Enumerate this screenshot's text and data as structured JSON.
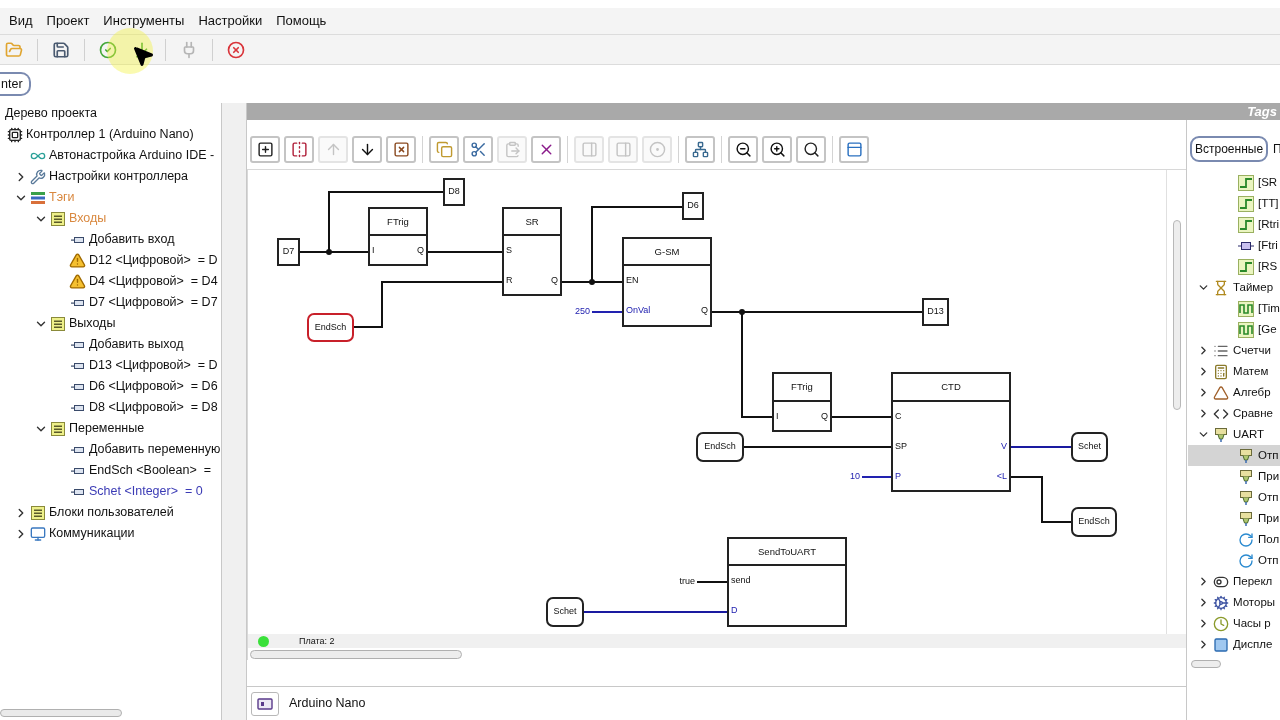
{
  "menu": [
    "Вид",
    "Проект",
    "Инструменты",
    "Настройки",
    "Помощь"
  ],
  "toolbar": [
    [
      {
        "kind": "open",
        "disabled": false
      }
    ],
    [
      {
        "kind": "save",
        "disabled": false
      }
    ],
    [
      {
        "kind": "check",
        "disabled": false
      },
      {
        "kind": "upload",
        "disabled": false
      }
    ],
    [
      {
        "kind": "plug",
        "disabled": true
      }
    ],
    [
      {
        "kind": "stop",
        "disabled": false
      }
    ]
  ],
  "side_button": {
    "label": "nter"
  },
  "project_tree": {
    "title": "Дерево проекта",
    "items": [
      {
        "label": "Контроллер 1 (Arduino Nano)",
        "kind": "controller",
        "children": [
          {
            "label": "Автонастройка Arduino IDE -",
            "kind": "link"
          },
          {
            "label": "Настройки контроллера",
            "kind": "settings",
            "expanded": false
          },
          {
            "label": "Тэги",
            "kind": "tags",
            "expanded": true,
            "color": "#d9883f",
            "children": [
              {
                "label": "Входы",
                "kind": "group",
                "expanded": true,
                "color": "#d9883f",
                "children": [
                  {
                    "label": "Добавить вход",
                    "kind": "input"
                  },
                  {
                    "label": "D12 <Цифровой>  = D",
                    "kind": "warning"
                  },
                  {
                    "label": "D4 <Цифровой>  = D4",
                    "kind": "warning"
                  },
                  {
                    "label": "D7 <Цифровой>  = D7",
                    "kind": "input"
                  }
                ]
              },
              {
                "label": "Выходы",
                "kind": "group",
                "expanded": true,
                "children": [
                  {
                    "label": "Добавить выход",
                    "kind": "output"
                  },
                  {
                    "label": "D13 <Цифровой>  = D",
                    "kind": "output"
                  },
                  {
                    "label": "D6 <Цифровой>  = D6",
                    "kind": "output"
                  },
                  {
                    "label": "D8 <Цифровой>  = D8",
                    "kind": "output"
                  }
                ]
              },
              {
                "label": "Переменные",
                "kind": "group",
                "expanded": true,
                "children": [
                  {
                    "label": "Добавить переменную",
                    "kind": "input"
                  },
                  {
                    "label": "EndSch <Boolean>  =",
                    "kind": "input"
                  },
                  {
                    "label": "Schet <Integer>  = 0",
                    "kind": "input",
                    "color": "#3b3bb5"
                  }
                ]
              }
            ]
          },
          {
            "label": "Блоки пользователей",
            "kind": "group",
            "expanded": false
          },
          {
            "label": "Коммуникации",
            "kind": "comm",
            "expanded": false
          }
        ]
      }
    ]
  },
  "panel_header": {
    "title": "Tags"
  },
  "diagram_toolbar": [
    [
      {
        "kind": "insert",
        "disabled": false
      },
      {
        "kind": "mirror",
        "disabled": false
      },
      {
        "kind": "up",
        "disabled": true
      },
      {
        "kind": "down",
        "disabled": false
      },
      {
        "kind": "delete-block",
        "disabled": false
      }
    ],
    [
      {
        "kind": "copy",
        "disabled": false
      },
      {
        "kind": "cut",
        "disabled": false
      },
      {
        "kind": "paste",
        "disabled": true
      },
      {
        "kind": "delete",
        "disabled": false
      }
    ],
    [
      {
        "kind": "pin-left",
        "disabled": true
      },
      {
        "kind": "pin-right",
        "disabled": true
      },
      {
        "kind": "invert",
        "disabled": true
      }
    ],
    [
      {
        "kind": "tree",
        "disabled": false
      }
    ],
    [
      {
        "kind": "zoom-out",
        "disabled": false
      },
      {
        "kind": "zoom-in",
        "disabled": false
      },
      {
        "kind": "zoom-reset",
        "disabled": false
      }
    ],
    [
      {
        "kind": "properties",
        "disabled": false
      }
    ]
  ],
  "diagram": {
    "blocks": [
      {
        "title": "FTrig",
        "inputs": [
          {
            "name": "I",
            "kind": "bool"
          }
        ],
        "outputs": [
          {
            "name": "Q",
            "kind": "bool"
          }
        ]
      },
      {
        "title": "SR",
        "inputs": [
          {
            "name": "S",
            "kind": "bool"
          },
          {
            "name": "R",
            "kind": "bool"
          }
        ],
        "outputs": [
          {
            "name": "Q",
            "kind": "bool"
          }
        ]
      },
      {
        "title": "G-SM",
        "inputs": [
          {
            "name": "EN",
            "kind": "bool"
          },
          {
            "name": "OnVal",
            "kind": "int"
          }
        ],
        "outputs": [
          {
            "name": "Q",
            "kind": "bool"
          }
        ]
      },
      {
        "title": "FTrig",
        "inputs": [
          {
            "name": "I",
            "kind": "bool"
          }
        ],
        "outputs": [
          {
            "name": "Q",
            "kind": "bool"
          }
        ]
      },
      {
        "title": "CTD",
        "inputs": [
          {
            "name": "C",
            "kind": "bool"
          },
          {
            "name": "SP",
            "kind": "bool"
          },
          {
            "name": "P",
            "kind": "int"
          }
        ],
        "outputs": [
          {
            "name": "V",
            "kind": "int"
          },
          {
            "name": "<L",
            "kind": "int"
          }
        ]
      },
      {
        "title": "SendToUART",
        "inputs": [
          {
            "name": "send",
            "kind": "bool"
          },
          {
            "name": "D",
            "kind": "int"
          }
        ]
      }
    ],
    "tags": [
      {
        "label": "D8"
      },
      {
        "label": "D7"
      },
      {
        "label": "D6"
      },
      {
        "label": "D13"
      }
    ],
    "variables": [
      {
        "label": "EndSch",
        "selected": true
      },
      {
        "label": "EndSch",
        "selected": false
      },
      {
        "label": "Schet",
        "selected": false
      },
      {
        "label": "EndSch",
        "selected": false
      },
      {
        "label": "Schet",
        "selected": false
      }
    ],
    "constants": [
      {
        "label": "250",
        "kind": "int"
      },
      {
        "label": "10",
        "kind": "int"
      },
      {
        "label": "true",
        "kind": "bool"
      }
    ]
  },
  "status": {
    "board": "Плата: 2",
    "connected": true
  },
  "board_bar": {
    "label": "Arduino Nano"
  },
  "library": {
    "tabs": [
      {
        "label": "Встроенные",
        "selected": true
      },
      {
        "label": "П",
        "selected": false
      }
    ],
    "items": [
      {
        "children": [
          {
            "label": "[SR",
            "kind": "step"
          },
          {
            "label": "[TT]",
            "kind": "step"
          },
          {
            "label": "[Rtri",
            "kind": "step"
          },
          {
            "label": "[Ftri",
            "kind": "chip"
          },
          {
            "label": "[RS",
            "kind": "step"
          }
        ]
      },
      {
        "label": "Таймер",
        "kind": "timer",
        "expanded": true,
        "children": [
          {
            "label": "[Tim",
            "kind": "pulse"
          },
          {
            "label": "[Ge",
            "kind": "pulse"
          }
        ]
      },
      {
        "label": "Счетчи",
        "kind": "counter",
        "expanded": false
      },
      {
        "label": "Матем",
        "kind": "math",
        "expanded": false
      },
      {
        "label": "Алгебр",
        "kind": "algebra",
        "expanded": false
      },
      {
        "label": "Сравне",
        "kind": "compare",
        "expanded": false
      },
      {
        "label": "UART",
        "kind": "uart",
        "expanded": true,
        "children": [
          {
            "label": "Отп",
            "kind": "uart",
            "selected": true
          },
          {
            "label": "При",
            "kind": "uart",
            "selected": false
          },
          {
            "label": "Отп",
            "kind": "uart",
            "selected": false
          },
          {
            "label": "При",
            "kind": "uart",
            "selected": false
          },
          {
            "label": "Пол",
            "kind": "refresh",
            "selected": false
          },
          {
            "label": "Отп",
            "kind": "refresh",
            "selected": false
          }
        ]
      },
      {
        "label": "Перекл",
        "kind": "switch",
        "expanded": false
      },
      {
        "label": "Моторы",
        "kind": "motor",
        "expanded": false
      },
      {
        "label": "Часы р",
        "kind": "clock",
        "expanded": false
      },
      {
        "label": "Диспле",
        "kind": "display",
        "expanded": false
      }
    ]
  }
}
